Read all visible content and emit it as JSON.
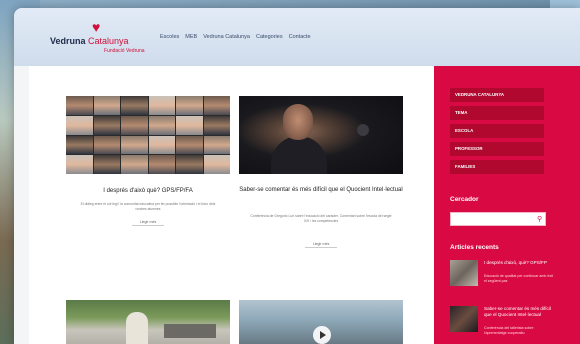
{
  "header": {
    "logo_name": "Vedruna",
    "logo_name_accent": "Catalunya",
    "logo_sub": "Fundació Vedruna",
    "nav": [
      "Escoles",
      "MEB",
      "Vedruna Catalunya",
      "Categories",
      "Contacte"
    ]
  },
  "posts": [
    {
      "title": "I després d'això què? GPS/FP/FA",
      "excerpt": "El diàleg entre el col·legi i la comunitat educativa per fer possible l'orientació i el futur dels nostres alumnes",
      "link": "Llegir més"
    },
    {
      "title": "Saber-se comentar és més difícil que el Quocient Intel·lectual",
      "excerpt": "Conferència de Gregorio Luri sobre l'educació del caràcter. Comentari sobre l'escola del segle XXI i les competències",
      "link": "Llegir més"
    }
  ],
  "sidebar": {
    "menu": [
      "VEDRUNA CATALUNYA",
      "TEMA",
      "ESCOLA",
      "PROFESSOR",
      "FAMILIES"
    ],
    "search_heading": "Cercador",
    "recent_heading": "Articles recents",
    "recent": [
      {
        "title": "I després d'això, què? GPS/FP",
        "excerpt": "Educació de qualitat per continuar amb èxit el següent pas"
      },
      {
        "title": "Saber-se comentar és més difícil que el Quocient Intel·lectual",
        "excerpt": "Conferència del tallerista sobre l'aprenentatge cooperatiu"
      }
    ]
  },
  "colors": {
    "accent": "#d90a43",
    "header_bg": "#d6e2f0"
  }
}
